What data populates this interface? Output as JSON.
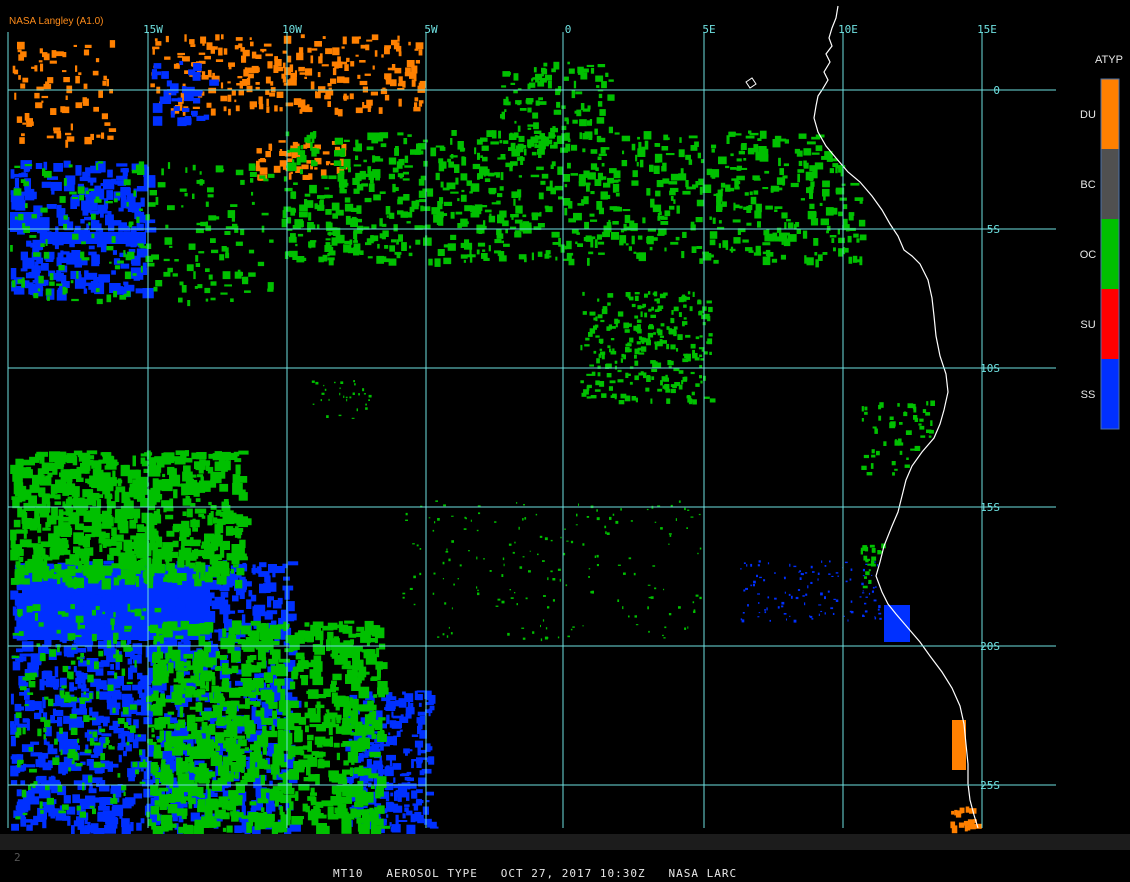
{
  "header": {
    "credit": "NASA Langley (A1.0)"
  },
  "legend": {
    "title": "ATYP",
    "classes": [
      {
        "label": "DU",
        "color": "#ff8000"
      },
      {
        "label": "BC",
        "color": "#505050"
      },
      {
        "label": "OC",
        "color": "#00c000"
      },
      {
        "label": "SU",
        "color": "#ff0000"
      },
      {
        "label": "SS",
        "color": "#0030ff"
      }
    ]
  },
  "grid": {
    "color": "#6ee0e0",
    "longitude_labels": [
      "15W",
      "10W",
      "5W",
      "0",
      "5E",
      "10E",
      "15E"
    ],
    "latitude_labels": [
      "0",
      "5S",
      "10S",
      "15S",
      "20S",
      "25S"
    ]
  },
  "status_bar": {
    "frame": "2",
    "product": "MT10",
    "field": "AEROSOL TYPE",
    "date": "OCT 27, 2017",
    "time": "10:30Z",
    "source": "NASA LARC"
  }
}
